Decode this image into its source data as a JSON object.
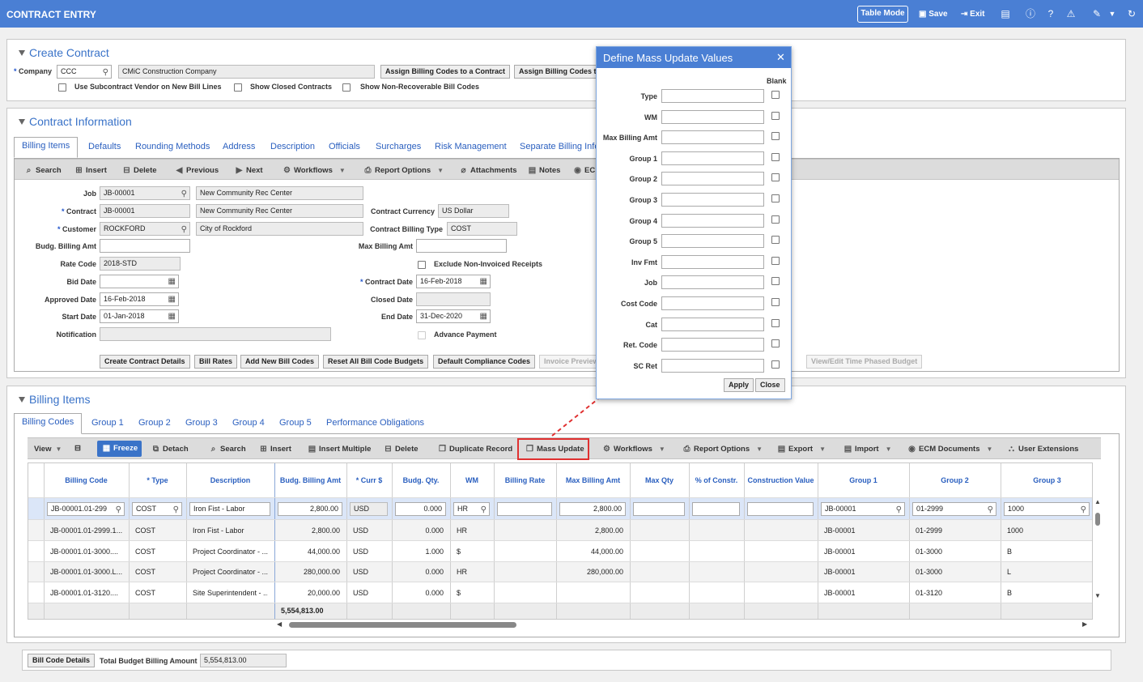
{
  "app": {
    "title": "CONTRACT ENTRY",
    "table_mode": "Table Mode",
    "save": "Save",
    "exit": "Exit"
  },
  "create": {
    "title": "Create Contract",
    "company_label": "Company",
    "company_value": "CCC",
    "company_name": "CMiC Construction Company",
    "btn_assign1": "Assign Billing Codes to a Contract",
    "btn_assign2": "Assign Billing Codes to",
    "chk1": "Use Subcontract Vendor on New Bill Lines",
    "chk2": "Show Closed Contracts",
    "chk3": "Show Non-Recoverable Bill Codes"
  },
  "info": {
    "title": "Contract Information",
    "tabs": [
      "Billing Items",
      "Defaults",
      "Rounding Methods",
      "Address",
      "Description",
      "Officials",
      "Surcharges",
      "Risk Management",
      "Separate Billing Info"
    ],
    "toolbar": [
      "Search",
      "Insert",
      "Delete",
      "Previous",
      "Next",
      "Workflows",
      "Report Options",
      "Attachments",
      "Notes",
      "EC"
    ],
    "job_label": "Job",
    "job": "JB-00001",
    "job_name": "New Community Rec Center",
    "contract_label": "Contract",
    "contract": "JB-00001",
    "contract_name": "New Community Rec Center",
    "customer_label": "Customer",
    "customer": "ROCKFORD",
    "customer_name": "City of Rockford",
    "budg_label": "Budg. Billing Amt",
    "rate_label": "Rate Code",
    "rate": "2018-STD",
    "bid_label": "Bid Date",
    "approved_label": "Approved Date",
    "approved": "16-Feb-2018",
    "start_label": "Start Date",
    "start": "01-Jan-2018",
    "notif_label": "Notification",
    "currency_label": "Contract Currency",
    "currency": "US Dollar",
    "billtype_label": "Contract Billing Type",
    "billtype": "COST",
    "maxbill_label": "Max Billing Amt",
    "exclude_label": "Exclude Non-Invoiced Receipts",
    "cdate_label": "Contract Date",
    "cdate": "16-Feb-2018",
    "closed_label": "Closed Date",
    "end_label": "End Date",
    "end": "31-Dec-2020",
    "advance_label": "Advance Payment",
    "buttons": [
      "Create Contract Details",
      "Bill Rates",
      "Add New Bill Codes",
      "Reset All Bill Code Budgets",
      "Default Compliance Codes",
      "Invoice Preview"
    ],
    "btn_right": "View/Edit Time Phased Budget"
  },
  "items": {
    "title": "Billing Items",
    "tabs": [
      "Billing Codes",
      "Group 1",
      "Group 2",
      "Group 3",
      "Group 4",
      "Group 5",
      "Performance Obligations"
    ],
    "toolbar": {
      "view": "View",
      "freeze": "Freeze",
      "detach": "Detach",
      "search": "Search",
      "insert": "Insert",
      "insert_multiple": "Insert Multiple",
      "delete": "Delete",
      "duplicate": "Duplicate Record",
      "mass_update": "Mass Update",
      "workflows": "Workflows",
      "report": "Report Options",
      "export": "Export",
      "import": "Import",
      "ecm": "ECM Documents",
      "user_ext": "User Extensions"
    },
    "columns": [
      "Billing Code",
      "* Type",
      "Description",
      "Budg. Billing Amt",
      "* Curr $",
      "Budg. Qty.",
      "WM",
      "Billing Rate",
      "Max Billing Amt",
      "Max Qty",
      "% of Constr.",
      "Construction Value",
      "Group 1",
      "Group 2",
      "Group 3"
    ],
    "edit_row": [
      "JB-00001.01-299",
      "COST",
      "Iron Fist - Labor",
      "2,800.00",
      "USD",
      "0.000",
      "HR",
      "",
      "2,800.00",
      "",
      "",
      "",
      "JB-00001",
      "01-2999",
      "1000"
    ],
    "rows": [
      [
        "JB-00001.01-2999.1...",
        "COST",
        "Iron Fist - Labor",
        "2,800.00",
        "USD",
        "0.000",
        "HR",
        "",
        "2,800.00",
        "",
        "",
        "",
        "JB-00001",
        "01-2999",
        "1000"
      ],
      [
        "JB-00001.01-3000....",
        "COST",
        "Project Coordinator - ...",
        "44,000.00",
        "USD",
        "1.000",
        "$",
        "",
        "44,000.00",
        "",
        "",
        "",
        "JB-00001",
        "01-3000",
        "B"
      ],
      [
        "JB-00001.01-3000.L...",
        "COST",
        "Project Coordinator - ...",
        "280,000.00",
        "USD",
        "0.000",
        "HR",
        "",
        "280,000.00",
        "",
        "",
        "",
        "JB-00001",
        "01-3000",
        "L"
      ],
      [
        "JB-00001.01-3120....",
        "COST",
        "Site Superintendent - ...",
        "20,000.00",
        "USD",
        "0.000",
        "$",
        "",
        "",
        "",
        "",
        "",
        "JB-00001",
        "01-3120",
        "B"
      ]
    ],
    "total": "5,554,813.00"
  },
  "footer": {
    "btn": "Bill Code Details",
    "label": "Total Budget Billing Amount",
    "value": "5,554,813.00"
  },
  "dialog": {
    "title": "Define Mass Update Values",
    "blank": "Blank",
    "fields": [
      "Type",
      "WM",
      "Max Billing Amt",
      "Group 1",
      "Group 2",
      "Group 3",
      "Group 4",
      "Group 5",
      "Inv Fmt",
      "Job",
      "Cost Code",
      "Cat",
      "Ret. Code",
      "SC Ret"
    ],
    "apply": "Apply",
    "close": "Close"
  },
  "colors": {
    "accent": "#4a7fd4",
    "highlight": "#e03030"
  }
}
